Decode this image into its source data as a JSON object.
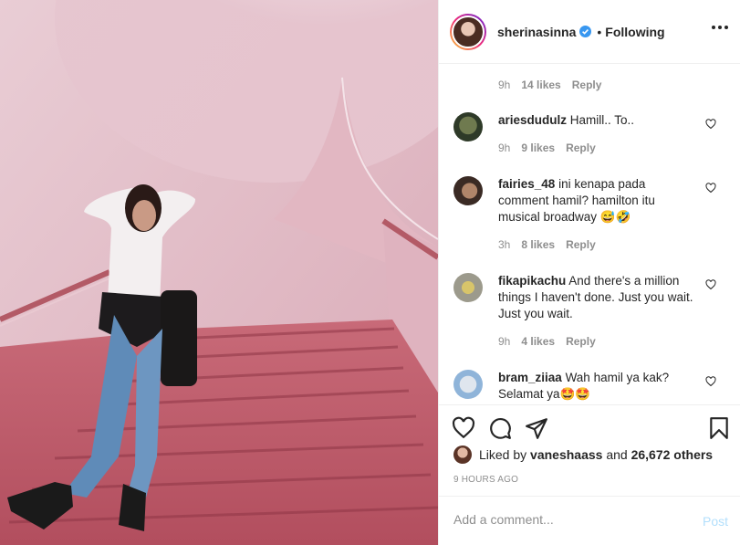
{
  "post": {
    "username": "sherinasinna",
    "separator": "•",
    "follow_status": "Following",
    "photo_alt": "Woman posing on red-carpeted staircase"
  },
  "first_meta": {
    "time": "9h",
    "likes": "14 likes",
    "reply": "Reply"
  },
  "comments": [
    {
      "user": "ariesdudulz",
      "text": "Hamill.. To..",
      "time": "9h",
      "likes": "9 likes",
      "reply": "Reply"
    },
    {
      "user": "fairies_48",
      "text": "ini kenapa pada comment hamil? hamilton itu musical broadway 😅🤣",
      "time": "3h",
      "likes": "8 likes",
      "reply": "Reply"
    },
    {
      "user": "fikapikachu",
      "text": "And there's a million things I haven't done. Just you wait. Just you wait.",
      "time": "9h",
      "likes": "4 likes",
      "reply": "Reply"
    },
    {
      "user": "bram_ziiaa",
      "text": "Wah hamil ya kak? Selamat ya🤩🤩"
    }
  ],
  "likes_summary": {
    "prefix": "Liked by",
    "user": "vaneshaass",
    "conjunction": "and",
    "count": "26,672 others"
  },
  "timestamp": "9 HOURS AGO",
  "composer": {
    "placeholder": "Add a comment...",
    "post_label": "Post"
  },
  "icons": {
    "like": "heart-icon",
    "comment": "comment-icon",
    "share": "share-icon",
    "save": "bookmark-icon",
    "more": "more-options-icon",
    "verified": "verified-badge-icon"
  },
  "colors": {
    "text": "#262626",
    "muted": "#8e8e8e",
    "border": "#efefef",
    "verified": "#3897f0",
    "post_disabled": "#b2dffc"
  }
}
